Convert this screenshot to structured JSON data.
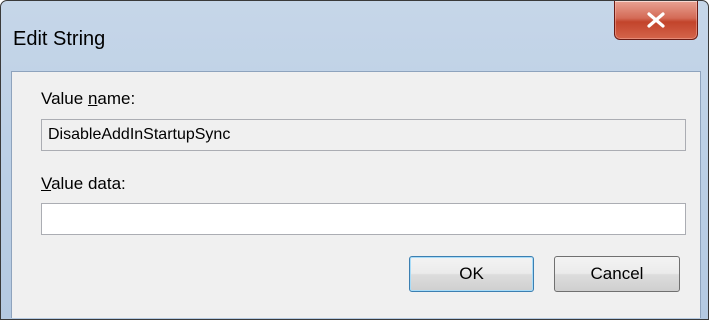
{
  "window": {
    "title": "Edit String",
    "close_icon": "close-x-icon",
    "close_color": "#c7432b"
  },
  "form": {
    "value_name_label": "Value name:",
    "value_name_mnemonic": "n",
    "value_name": "DisableAddInStartupSync",
    "value_data_label": "Value data:",
    "value_data_mnemonic": "V",
    "value_data": ""
  },
  "buttons": {
    "ok": "OK",
    "cancel": "Cancel"
  }
}
